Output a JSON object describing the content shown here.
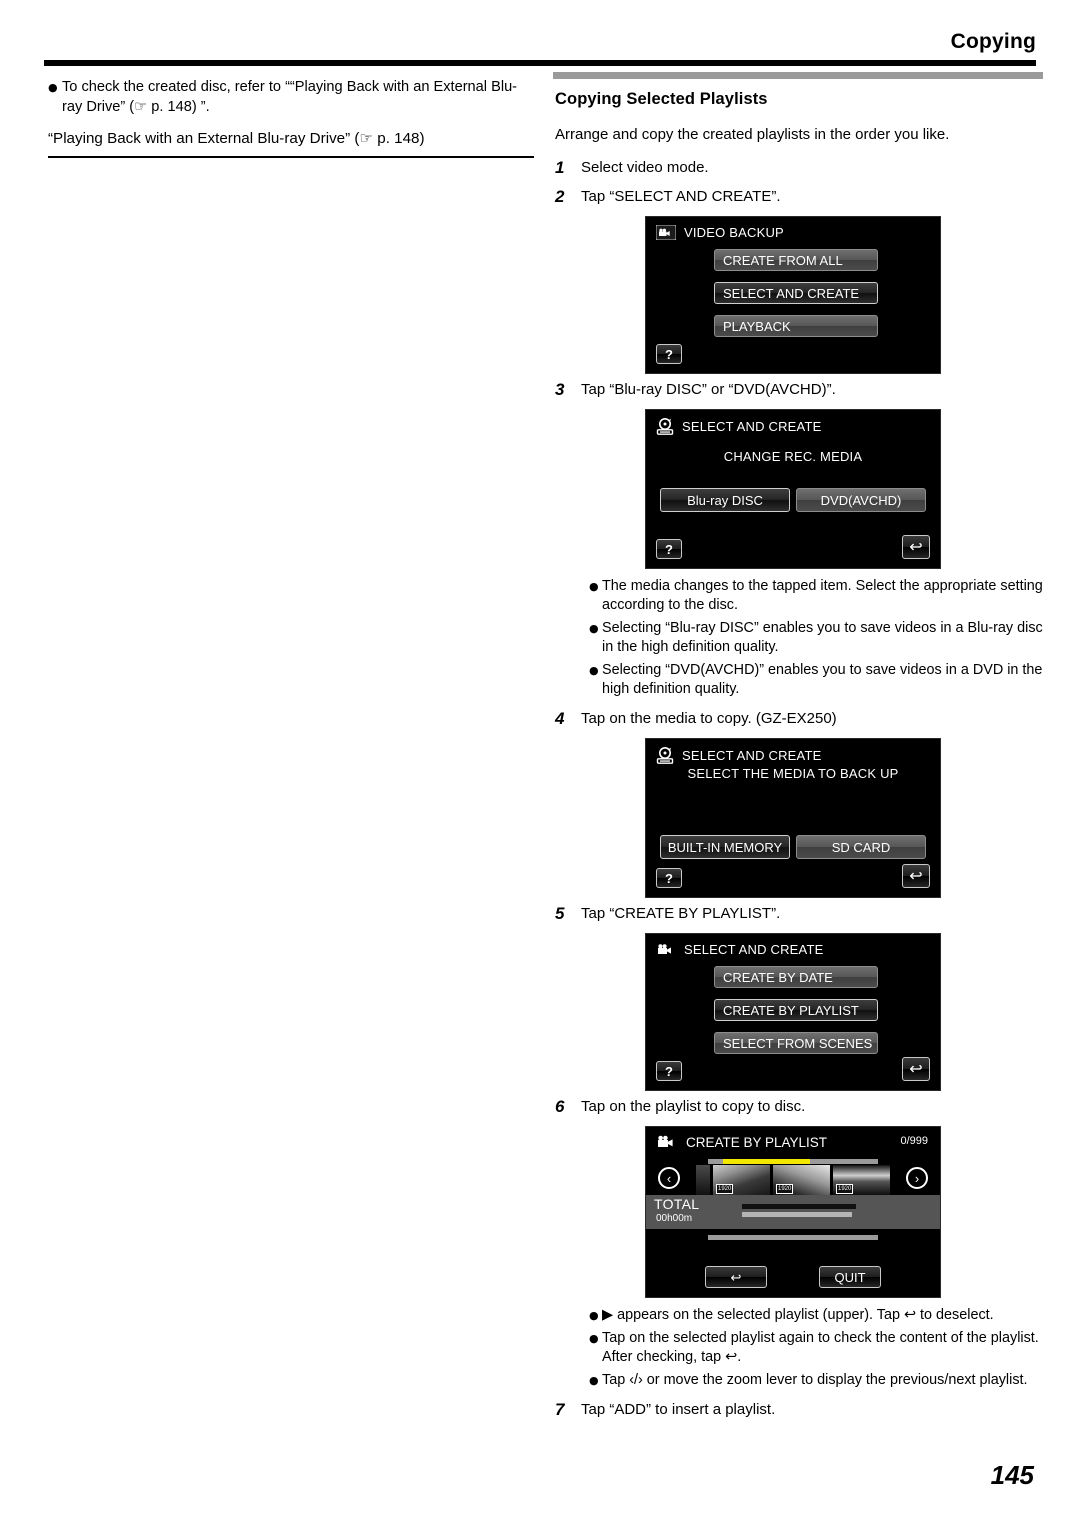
{
  "header": {
    "title": "Copying"
  },
  "page_number": "145",
  "left_column": {
    "bullet": "To check the created disc, refer to ““Playing Back with an External Blu-ray Drive” (☞ p. 148) ”.",
    "reference_link": "“Playing Back with an External Blu-ray Drive” (☞ p. 148)"
  },
  "right_column": {
    "section_title": "Copying Selected Playlists",
    "lead": "Arrange and copy the created playlists in the order you like.",
    "steps": [
      {
        "num": "1",
        "text": "Select video mode."
      },
      {
        "num": "2",
        "text": "Tap “SELECT AND CREATE”."
      },
      {
        "num": "3",
        "text": "Tap “Blu-ray DISC” or “DVD(AVCHD)”."
      },
      {
        "num": "4",
        "text": "Tap on the media to copy. (GZ-EX250)"
      },
      {
        "num": "5",
        "text": "Tap “CREATE BY PLAYLIST”."
      },
      {
        "num": "6",
        "text": "Tap on the playlist to copy to disc."
      },
      {
        "num": "7",
        "text": "Tap “ADD” to insert a playlist."
      }
    ],
    "notes_after_step3": [
      "The media changes to the tapped item. Select the appropriate setting according to the disc.",
      "Selecting “Blu-ray DISC” enables you to save videos in a Blu-ray disc in the high definition quality.",
      "Selecting “DVD(AVCHD)” enables you to save videos in a DVD in the high definition quality."
    ],
    "notes_after_step6": [
      "▶ appears on the selected playlist (upper). Tap ↩ to deselect.",
      "Tap on the selected playlist again to check the content of the playlist. After checking, tap ↩.",
      "Tap ‹/› or move the zoom lever to display the previous/next playlist."
    ]
  },
  "screens": {
    "video_backup": {
      "icon": "video-camera-icon",
      "title": "VIDEO BACKUP",
      "buttons": [
        {
          "label": "CREATE FROM ALL",
          "selected": false
        },
        {
          "label": "SELECT AND CREATE",
          "selected": true
        },
        {
          "label": "PLAYBACK",
          "selected": false
        }
      ],
      "help_label": "?"
    },
    "change_rec_media": {
      "icon": "disc-drive-icon",
      "title": "SELECT AND CREATE",
      "subtitle": "CHANGE REC. MEDIA",
      "buttons": [
        {
          "label": "Blu-ray DISC",
          "selected": true
        },
        {
          "label": "DVD(AVCHD)",
          "selected": false
        }
      ],
      "help_label": "?",
      "back_label": "↩"
    },
    "select_media": {
      "icon": "disc-drive-icon",
      "title": "SELECT AND CREATE",
      "subtitle": "SELECT THE MEDIA TO BACK UP",
      "buttons": [
        {
          "label": "BUILT-IN MEMORY",
          "selected": true
        },
        {
          "label": "SD CARD",
          "selected": false
        }
      ],
      "help_label": "?",
      "back_label": "↩"
    },
    "select_and_create": {
      "icon": "video-camera-icon",
      "title": "SELECT AND CREATE",
      "buttons": [
        {
          "label": "CREATE BY DATE",
          "selected": false
        },
        {
          "label": "CREATE BY PLAYLIST",
          "selected": true
        },
        {
          "label": "SELECT FROM SCENES",
          "selected": false
        }
      ],
      "help_label": "?",
      "back_label": "↩"
    },
    "create_by_playlist": {
      "icon": "video-camera-icon",
      "title": "CREATE BY PLAYLIST",
      "count": "0/999",
      "total_label": "TOTAL",
      "total_value": "00h00m",
      "thumbnail_tags": [
        "1920",
        "1920",
        "1920"
      ],
      "prev_arrow": "‹",
      "next_arrow": "›",
      "back_label": "↩",
      "quit_label": "QUIT"
    }
  }
}
